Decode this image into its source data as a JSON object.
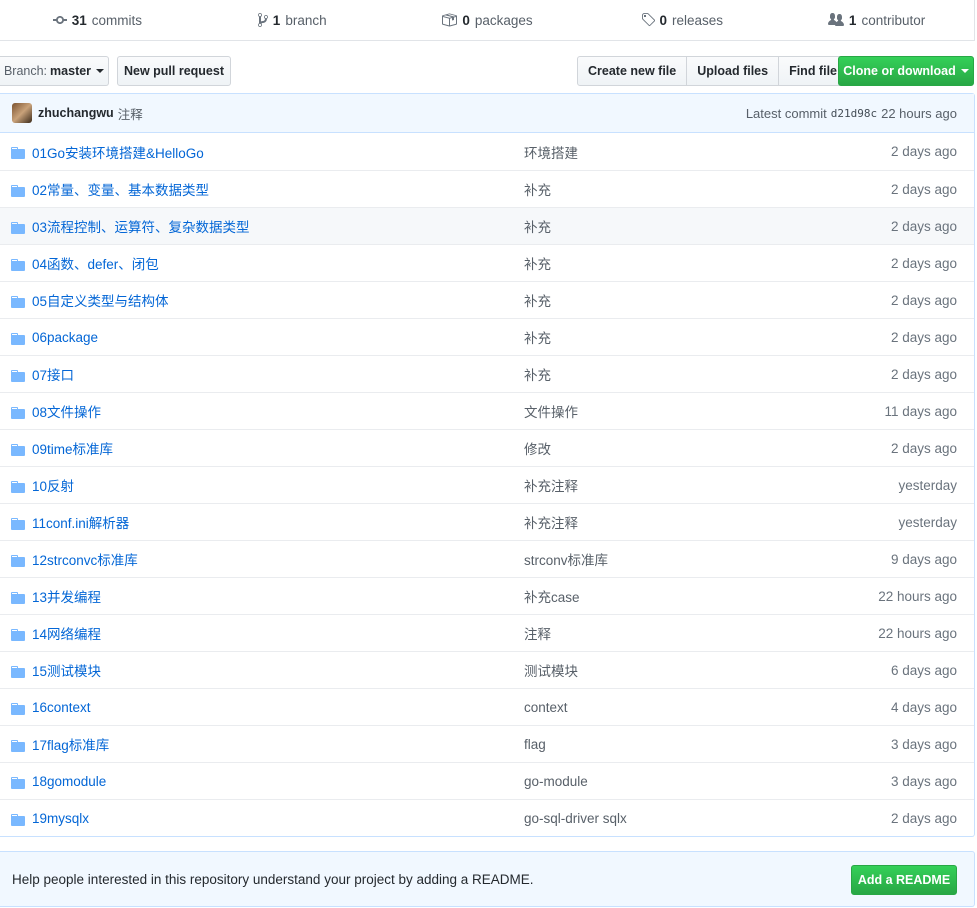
{
  "summary": {
    "commits": {
      "count": "31",
      "label": "commits"
    },
    "branches": {
      "count": "1",
      "label": "branch"
    },
    "packages": {
      "count": "0",
      "label": "packages"
    },
    "releases": {
      "count": "0",
      "label": "releases"
    },
    "contributors": {
      "count": "1",
      "label": "contributor"
    }
  },
  "toolbar": {
    "branch_prefix": "Branch:",
    "branch_name": "master",
    "new_pull_request": "New pull request",
    "create_new_file": "Create new file",
    "upload_files": "Upload files",
    "find_file": "Find file",
    "clone_or_download": "Clone or download"
  },
  "commit": {
    "author": "zhuchangwu",
    "message": "注释",
    "latest_label": "Latest commit",
    "sha": "d21d98c",
    "age": "22 hours ago"
  },
  "files": [
    {
      "name": "01Go安装环境搭建&HelloGo",
      "message": "环境搭建",
      "age": "2 days ago"
    },
    {
      "name": "02常量、变量、基本数据类型",
      "message": "补充",
      "age": "2 days ago"
    },
    {
      "name": "03流程控制、运算符、复杂数据类型",
      "message": "补充",
      "age": "2 days ago"
    },
    {
      "name": "04函数、defer、闭包",
      "message": "补充",
      "age": "2 days ago"
    },
    {
      "name": "05自定义类型与结构体",
      "message": "补充",
      "age": "2 days ago"
    },
    {
      "name": "06package",
      "message": "补充",
      "age": "2 days ago"
    },
    {
      "name": "07接口",
      "message": "补充",
      "age": "2 days ago"
    },
    {
      "name": "08文件操作",
      "message": "文件操作",
      "age": "11 days ago"
    },
    {
      "name": "09time标准库",
      "message": "修改",
      "age": "2 days ago"
    },
    {
      "name": "10反射",
      "message": "补充注释",
      "age": "yesterday"
    },
    {
      "name": "11conf.ini解析器",
      "message": "补充注释",
      "age": "yesterday"
    },
    {
      "name": "12strconvc标准库",
      "message": "strconv标准库",
      "age": "9 days ago"
    },
    {
      "name": "13并发编程",
      "message": "补充case",
      "age": "22 hours ago"
    },
    {
      "name": "14网络编程",
      "message": "注释",
      "age": "22 hours ago"
    },
    {
      "name": "15测试模块",
      "message": "测试模块",
      "age": "6 days ago"
    },
    {
      "name": "16context",
      "message": "context",
      "age": "4 days ago"
    },
    {
      "name": "17flag标准库",
      "message": "flag",
      "age": "3 days ago"
    },
    {
      "name": "18gomodule",
      "message": "go-module",
      "age": "3 days ago"
    },
    {
      "name": "19mysqlx",
      "message": "go-sql-driver sqlx",
      "age": "2 days ago"
    }
  ],
  "readme": {
    "prompt": "Help people interested in this repository understand your project by adding a README.",
    "button": "Add a README"
  },
  "icons": {
    "commits": "commit-icon",
    "branch": "branch-icon",
    "packages": "package-icon",
    "releases": "tag-icon",
    "contributors": "people-icon",
    "folder": "folder-icon"
  },
  "colors": {
    "link": "#0366d6",
    "green_button": "#28a745",
    "commit_bar_bg": "#f1f8ff"
  }
}
